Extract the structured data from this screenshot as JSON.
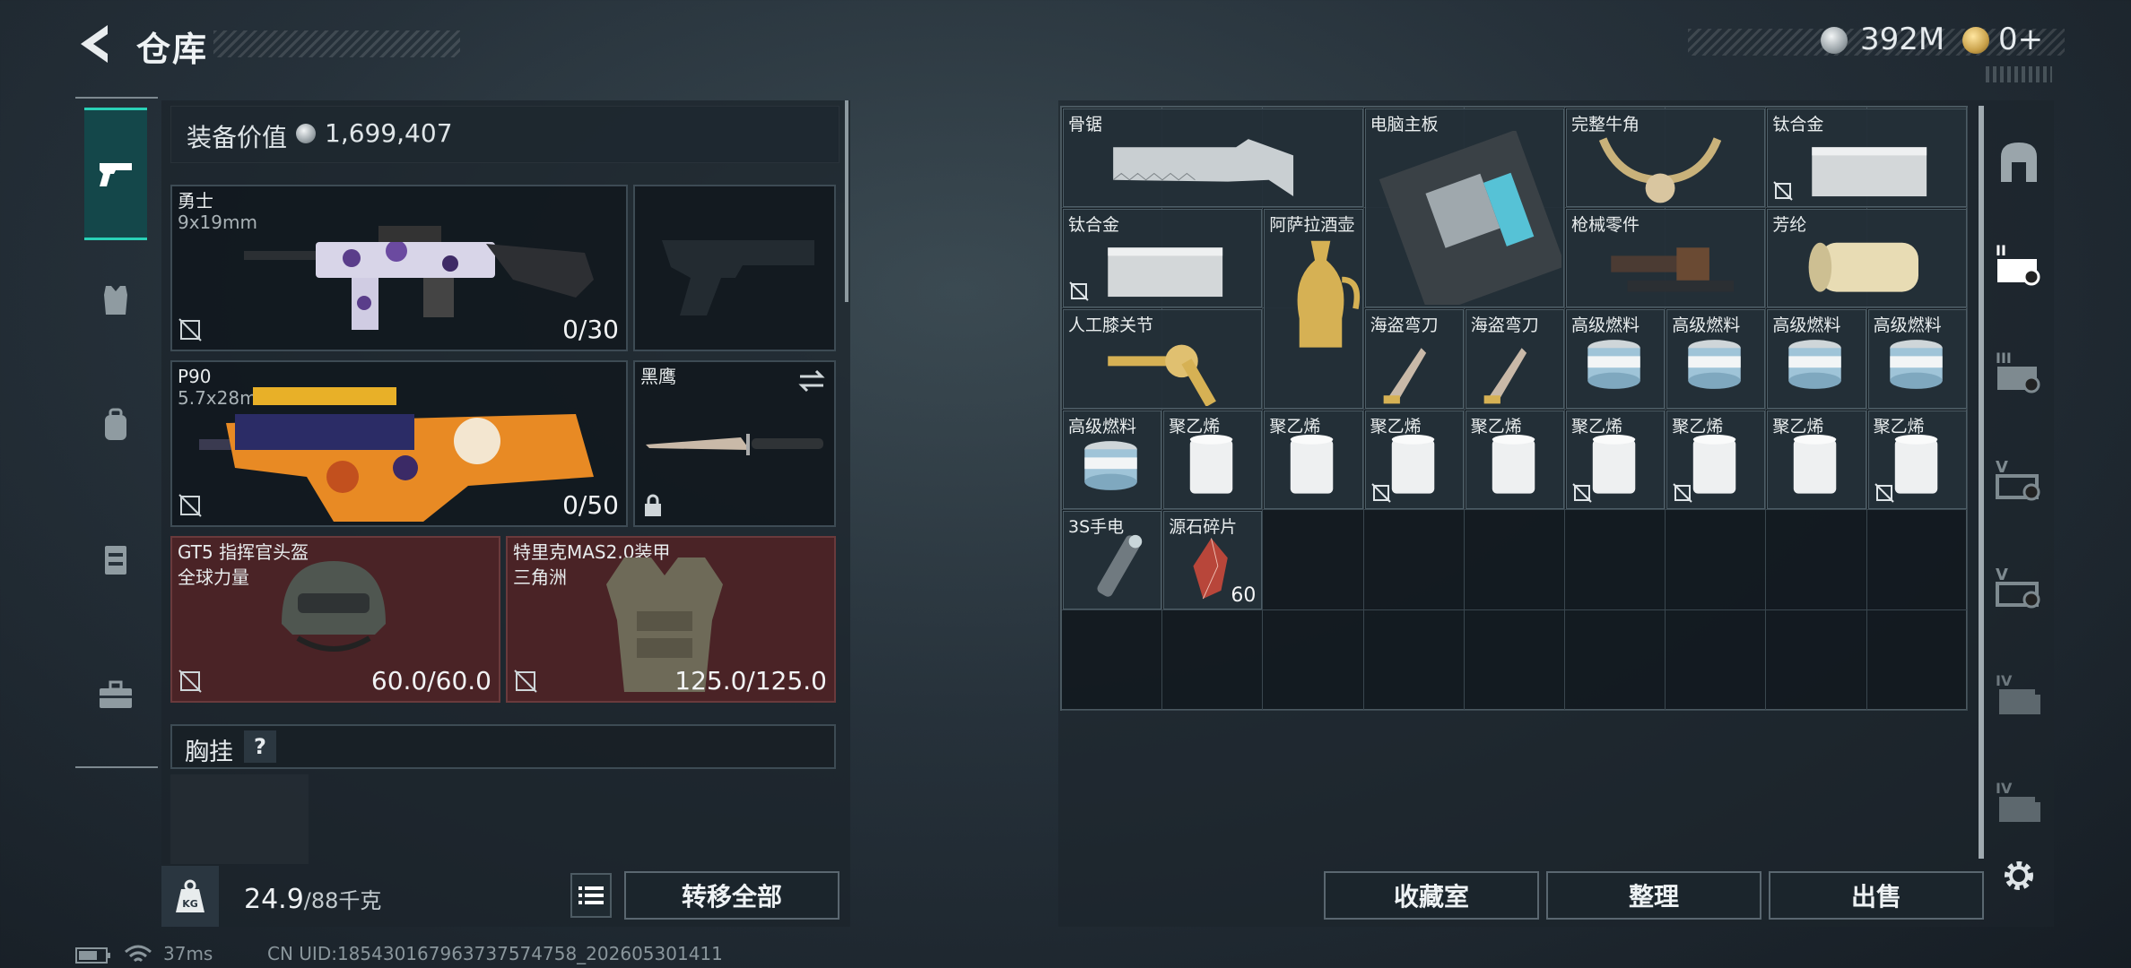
{
  "header": {
    "title": "仓库",
    "currency_silver": "392M",
    "currency_gold": "0+"
  },
  "rail": {
    "icons": [
      "pistol-icon",
      "armor-vest-icon",
      "backpack-icon",
      "chest-rig-icon",
      "toolbox-icon"
    ]
  },
  "loadout": {
    "value_label": "装备价值",
    "value": "1,699,407",
    "primary": {
      "name": "勇士",
      "ammo_type": "9x19mm",
      "ammo": "0/30"
    },
    "secondary": {
      "name": "P90",
      "ammo_type": "5.7x28mm",
      "ammo": "0/50"
    },
    "melee": {
      "name": "黑鹰"
    },
    "helmet": {
      "name": "GT5 指挥官头盔",
      "sub": "全球力量",
      "durability": "60.0/60.0"
    },
    "armor": {
      "name": "特里克MAS2.0装甲",
      "sub": "三角洲",
      "durability": "125.0/125.0"
    },
    "chest_rig": {
      "label": "胸挂",
      "help": "?"
    },
    "weight": {
      "current": "24.9",
      "max": "/88千克",
      "icon": "KG"
    },
    "transfer_all": "转移全部"
  },
  "stash": {
    "items": [
      {
        "name": "骨锯",
        "kind": "saw"
      },
      {
        "name": "电脑主板",
        "kind": "board"
      },
      {
        "name": "完整牛角",
        "kind": "horn"
      },
      {
        "name": "钛合金",
        "kind": "plate",
        "locked": true
      },
      {
        "name": "钛合金",
        "kind": "plate",
        "locked": true
      },
      {
        "name": "阿萨拉酒壶",
        "kind": "jug"
      },
      {
        "name": "枪械零件",
        "kind": "parts"
      },
      {
        "name": "芳纶",
        "kind": "roll"
      },
      {
        "name": "人工膝关节",
        "kind": "knee"
      },
      {
        "name": "海盗弯刀",
        "kind": "dagger"
      },
      {
        "name": "海盗弯刀",
        "kind": "dagger"
      },
      {
        "name": "高级燃料",
        "kind": "fuel"
      },
      {
        "name": "高级燃料",
        "kind": "fuel"
      },
      {
        "name": "高级燃料",
        "kind": "fuel"
      },
      {
        "name": "高级燃料",
        "kind": "fuel"
      },
      {
        "name": "高级燃料",
        "kind": "fuel"
      },
      {
        "name": "聚乙烯",
        "kind": "spool"
      },
      {
        "name": "聚乙烯",
        "kind": "spool"
      },
      {
        "name": "聚乙烯",
        "kind": "spool",
        "locked": true
      },
      {
        "name": "聚乙烯",
        "kind": "spool"
      },
      {
        "name": "聚乙烯",
        "kind": "spool",
        "locked": true
      },
      {
        "name": "聚乙烯",
        "kind": "spool",
        "locked": true
      },
      {
        "name": "聚乙烯",
        "kind": "spool"
      },
      {
        "name": "聚乙烯",
        "kind": "spool",
        "locked": true
      },
      {
        "name": "3S手电",
        "kind": "flashlight"
      },
      {
        "name": "源石碎片",
        "kind": "shard",
        "qty": "60"
      }
    ],
    "buttons": {
      "collection": "收藏室",
      "sort": "整理",
      "sell": "出售"
    }
  },
  "right_tabs": [
    "vault-icon",
    "storage-tier-2-icon",
    "storage-tier-3-icon",
    "storage-tier-5-icon",
    "storage-tier-5b-icon",
    "storage-tier-4-icon",
    "storage-tier-4b-icon",
    "settings-gear-icon"
  ],
  "status": {
    "ping": "37ms",
    "uid": "CN UID:185430167963737574758_202605301411"
  },
  "colors": {
    "accent": "#2ad1b7",
    "red_slot": "#4a2326"
  }
}
